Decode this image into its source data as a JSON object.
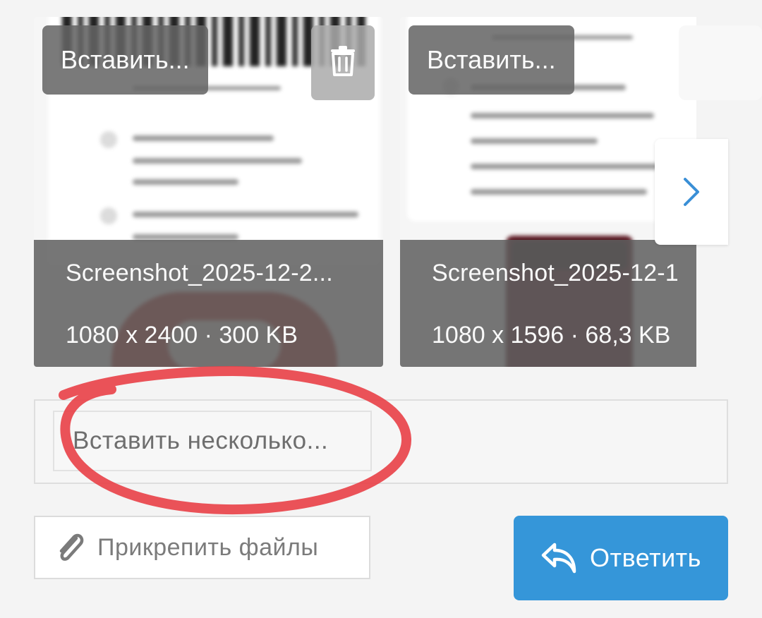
{
  "attachments": [
    {
      "insert_label": "Вставить...",
      "file_name": "Screenshot_2025-12-2...",
      "file_meta": "1080 x 2400 · 300 KB",
      "has_delete": true
    },
    {
      "insert_label": "Вставить...",
      "file_name": "Screenshot_2025-12-1",
      "file_meta": "1080 x 1596 · 68,3 KB",
      "has_delete": false
    }
  ],
  "icons": {
    "delete": "trash-icon",
    "next": "chevron-right-icon",
    "attach": "paperclip-icon",
    "reply": "reply-arrow-icon"
  },
  "insert_multiple_label": "Вставить несколько...",
  "attach_label": "Прикрепить файлы",
  "reply_label": "Ответить",
  "colors": {
    "reply_button": "#3596d9",
    "annotation": "#e8434a",
    "next_chevron": "#3a8fd6"
  }
}
